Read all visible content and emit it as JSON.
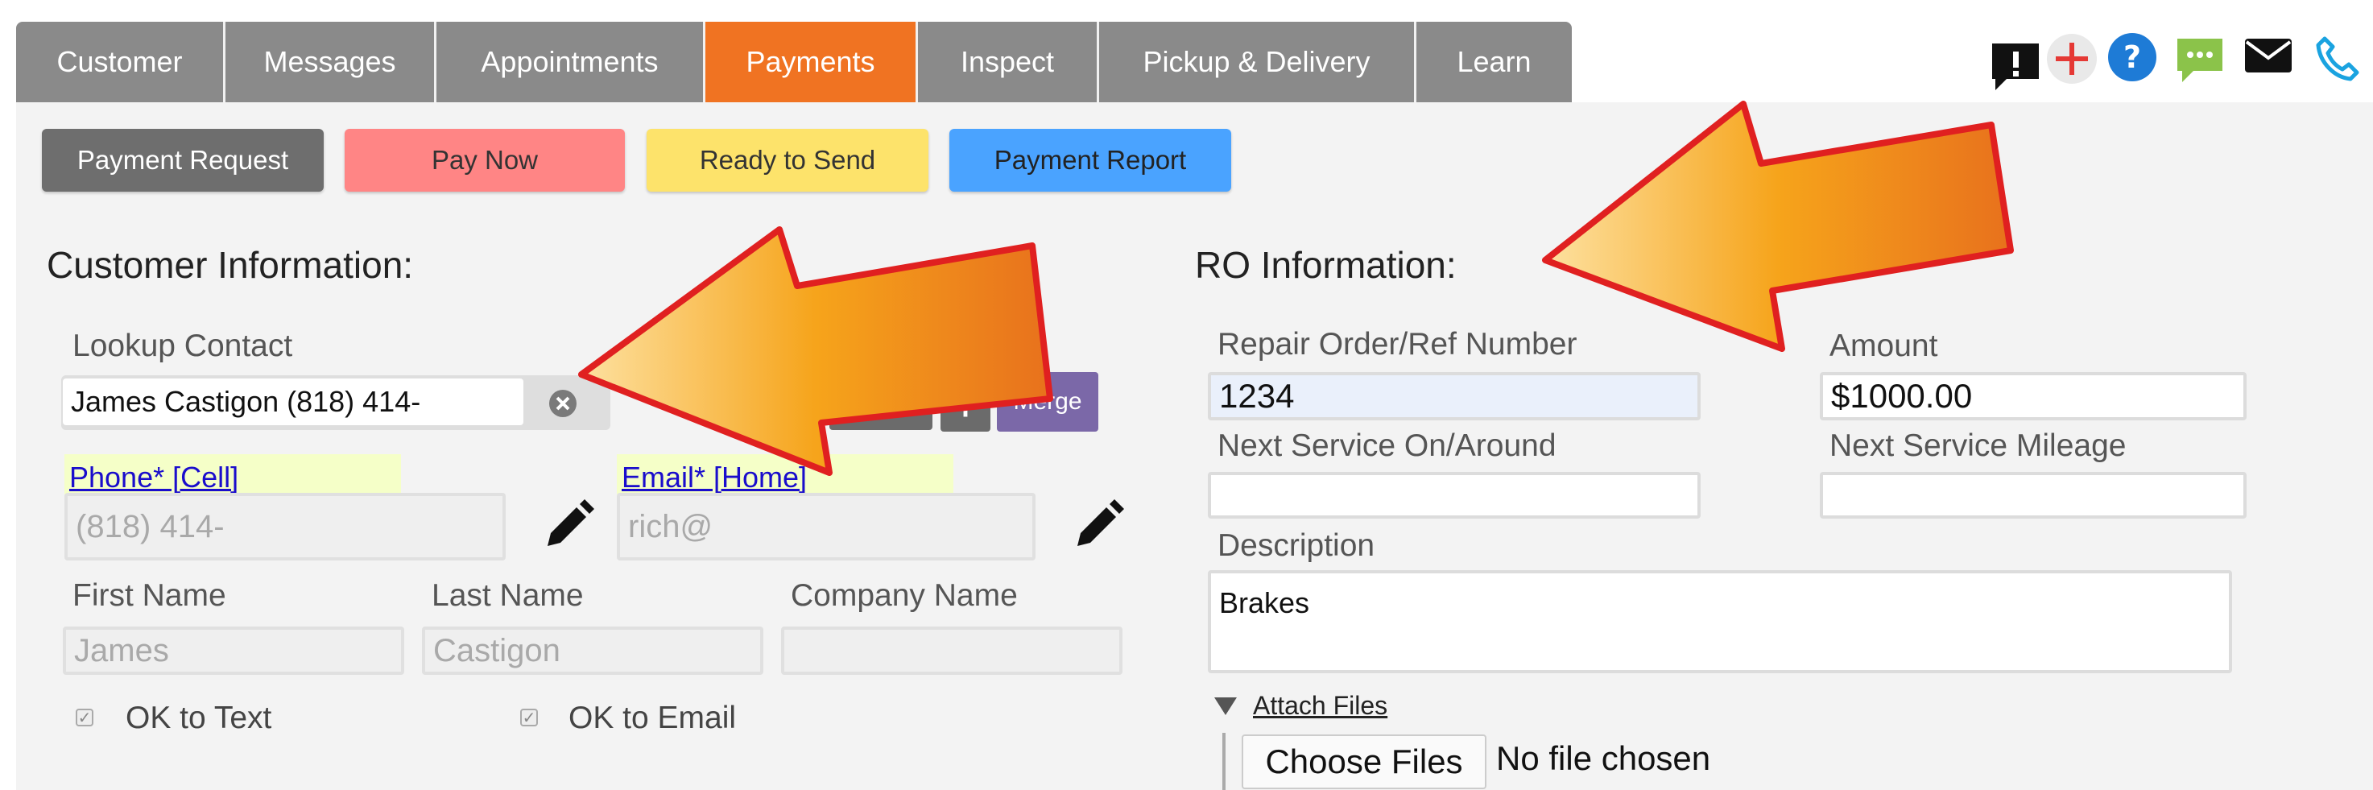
{
  "tabs": [
    {
      "label": "Customer"
    },
    {
      "label": "Messages"
    },
    {
      "label": "Appointments"
    },
    {
      "label": "Payments"
    },
    {
      "label": "Inspect"
    },
    {
      "label": "Pickup & Delivery"
    },
    {
      "label": "Learn"
    }
  ],
  "toolbar": {
    "payment_request": "Payment Request",
    "pay_now": "Pay Now",
    "ready_to_send": "Ready to Send",
    "payment_report": "Payment Report"
  },
  "customer": {
    "title": "Customer Information:",
    "lookup_label": "Lookup Contact",
    "lookup_value": "James Castigon (818) 414-",
    "edit_label": "Edit",
    "add_label": "+",
    "merge_label": "Merge",
    "phone_link": "Phone* [Cell]",
    "phone_value": "(818) 414-",
    "email_link": "Email* [Home]",
    "email_value": "rich@",
    "first_name_label": "First Name",
    "first_name_value": "James",
    "last_name_label": "Last Name",
    "last_name_value": "Castigon",
    "company_label": "Company Name",
    "company_value": "",
    "ok_text_label": "OK to Text",
    "ok_email_label": "OK to Email"
  },
  "ro": {
    "title": "RO Information:",
    "ro_number_label": "Repair Order/Ref Number",
    "ro_number_value": "1234",
    "amount_label": "Amount",
    "amount_value": "$1000.00",
    "next_service_label": "Next Service On/Around",
    "next_service_value": "",
    "next_mileage_label": "Next Service Mileage",
    "next_mileage_value": "",
    "description_label": "Description",
    "description_value": "Brakes",
    "attach_label": "Attach Files",
    "choose_files_label": "Choose Files",
    "no_file_label": "No file chosen"
  },
  "colors": {
    "active_tab": "#f07322",
    "pay_now": "#ff8585",
    "ready_to_send": "#fde36b",
    "payment_report": "#4aa3ff",
    "merge": "#7b68a8"
  },
  "icons": [
    "alert-icon",
    "add-icon",
    "help-icon",
    "chat-icon",
    "mail-icon",
    "phone-icon",
    "clear-icon",
    "pencil-icon",
    "arrow-annotation-icon"
  ]
}
